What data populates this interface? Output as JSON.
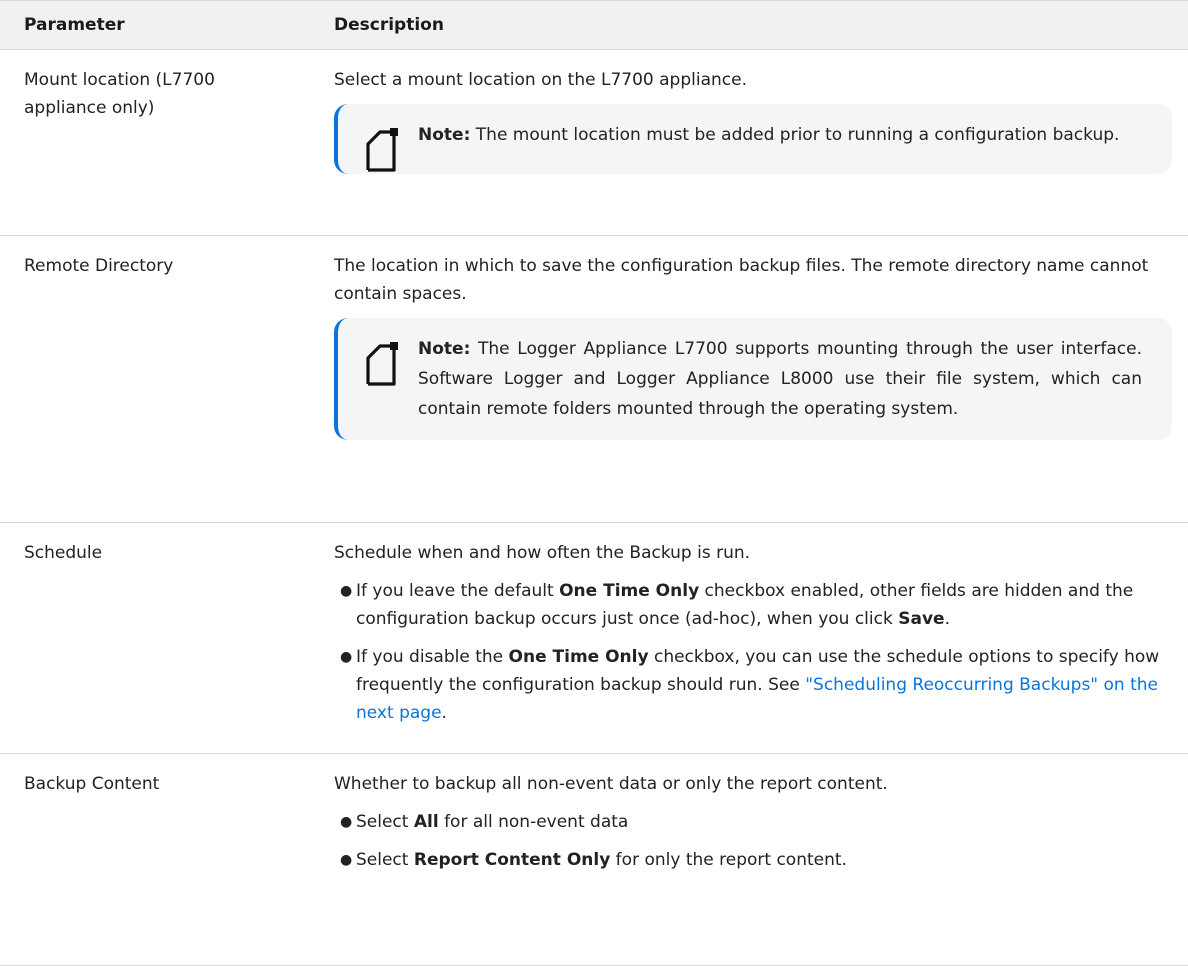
{
  "table": {
    "headers": {
      "parameter": "Parameter",
      "description": "Description"
    },
    "rows": {
      "mount": {
        "param": "Mount location (L7700 appliance only)",
        "desc": "Select a mount location on the L7700 appliance.",
        "note_label": "Note:",
        "note_text": " The mount location must be added prior to running a configuration backup."
      },
      "remote": {
        "param": "Remote Directory",
        "desc": "The location in which to save the configuration backup files. The remote directory name cannot contain spaces.",
        "note_label": "Note:",
        "note_text": " The Logger Appliance L7700 supports mounting through the user interface. Software Logger and Logger Appliance L8000 use their file system, which can contain remote folders mounted through the operating system."
      },
      "schedule": {
        "param": "Schedule",
        "desc": "Schedule when and how often the Backup is run.",
        "b1_pre": "If you leave the default ",
        "b1_bold": "One Time Only",
        "b1_mid": " checkbox enabled, other fields are hidden and the configuration backup occurs just once (ad-hoc), when you click ",
        "b1_bold2": "Save",
        "b1_post": ".",
        "b2_pre": "If you disable the ",
        "b2_bold": "One Time Only",
        "b2_mid": " checkbox, you can use the schedule options to specify how frequently the configuration backup should run. See ",
        "b2_link": "\"Scheduling Reoccurring Backups\" on the next page",
        "b2_post": "."
      },
      "content": {
        "param": "Backup Content",
        "desc": "Whether to backup all non-event data or only the report content.",
        "b1_pre": "Select ",
        "b1_bold": "All",
        "b1_post": " for all non-event data",
        "b2_pre": "Select ",
        "b2_bold": "Report Content Only",
        "b2_post": " for only the report content."
      }
    }
  },
  "icons": {
    "note": "note-icon"
  },
  "colors": {
    "accent": "#0a74da",
    "header_bg": "#f1f1f1",
    "note_bg": "#f3f5f7"
  }
}
